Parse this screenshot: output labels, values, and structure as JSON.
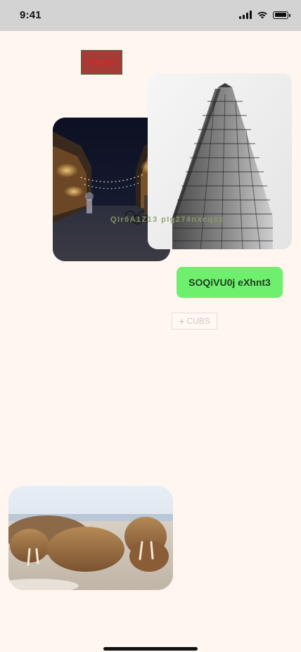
{
  "status_bar": {
    "time": "9:41",
    "icons": [
      "cellular-signal-icon",
      "wifi-icon",
      "battery-icon"
    ]
  },
  "reject_button": {
    "label": "Reject"
  },
  "images": [
    {
      "name": "street-photo",
      "subject": "night street with string lights"
    },
    {
      "name": "building-photo",
      "subject": "flatiron building black and white"
    },
    {
      "name": "walrus-photo",
      "subject": "walruses on beach"
    }
  ],
  "overlay_text": "QIr6A1Z13 pIg274nxcqxx",
  "primary_button": {
    "label": "SOQiVU0j eXhnt3"
  },
  "add_button": {
    "icon": "plus-icon",
    "icon_glyph": "+",
    "label": "CUBS"
  },
  "colors": {
    "background": "#fff6f0",
    "status_bar": "#d3d3d3",
    "reject_bg": "#a53b36",
    "reject_text": "#e0261f",
    "primary_bg": "#6ef06e",
    "overlay_text": "#8e9e66"
  }
}
